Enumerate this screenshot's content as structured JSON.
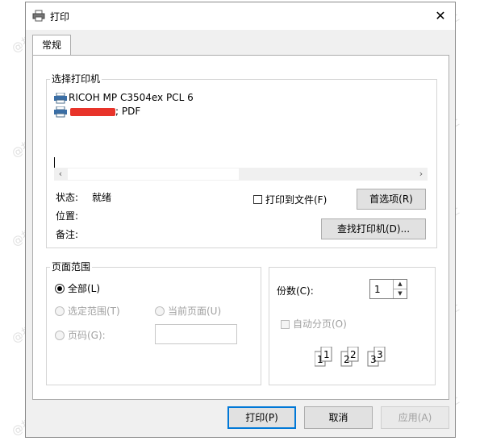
{
  "window": {
    "title": "打印",
    "close_glyph": "✕"
  },
  "tabs": [
    {
      "label": "常规"
    }
  ],
  "select_printer": {
    "group_title": "选择打印机",
    "printers": [
      {
        "name": "RICOH MP C3504ex PCL 6"
      },
      {
        "name": "; PDF"
      }
    ],
    "scroll_left": "‹",
    "scroll_right": "›",
    "status_label": "状态:",
    "status_value": "就绪",
    "location_label": "位置:",
    "comment_label": "备注:",
    "print_to_file_label": "打印到文件(F)",
    "preferences_button": "首选项(R)",
    "find_printer_button": "查找打印机(D)..."
  },
  "page_range": {
    "group_title": "页面范围",
    "all_label": "全部(L)",
    "selection_label": "选定范围(T)",
    "current_page_label": "当前页面(U)",
    "pages_label": "页码(G):",
    "pages_value": ""
  },
  "copies": {
    "copies_label": "份数(C):",
    "copies_value": "1",
    "collate_label": "自动分页(O)",
    "collate_pages": [
      "1",
      "1",
      "2",
      "2",
      "3",
      "3"
    ]
  },
  "footer": {
    "print_button": "打印(P)",
    "cancel_button": "取消",
    "apply_button": "应用(A)"
  },
  "watermark_text": "@打印机卫士",
  "colors": {
    "accent": "#0078d7",
    "window_bg": "#f0f0f0",
    "redaction": "#e8332a"
  }
}
